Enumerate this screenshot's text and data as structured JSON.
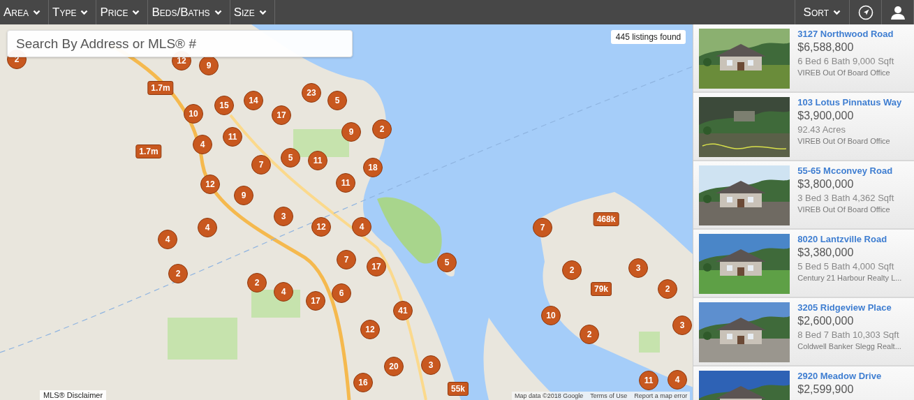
{
  "filters": [
    {
      "label": "Area"
    },
    {
      "label": "Type"
    },
    {
      "label": "Price"
    },
    {
      "label": "Beds/Baths"
    },
    {
      "label": "Size"
    }
  ],
  "sort": {
    "label": "Sort"
  },
  "search": {
    "placeholder": "Search By Address or MLS® #"
  },
  "listing_count": "445 listings found",
  "markers": [
    {
      "kind": "cluster",
      "label": "2"
    },
    {
      "kind": "cluster",
      "label": "12"
    },
    {
      "kind": "cluster",
      "label": "9"
    },
    {
      "kind": "price",
      "label": "1.7m"
    },
    {
      "kind": "cluster",
      "label": "23"
    },
    {
      "kind": "cluster",
      "label": "5"
    },
    {
      "kind": "cluster",
      "label": "14"
    },
    {
      "kind": "cluster",
      "label": "15"
    },
    {
      "kind": "cluster",
      "label": "10"
    },
    {
      "kind": "cluster",
      "label": "17"
    },
    {
      "kind": "cluster",
      "label": "9"
    },
    {
      "kind": "cluster",
      "label": "2"
    },
    {
      "kind": "cluster",
      "label": "11"
    },
    {
      "kind": "cluster",
      "label": "4"
    },
    {
      "kind": "price",
      "label": "1.7m"
    },
    {
      "kind": "cluster",
      "label": "5"
    },
    {
      "kind": "cluster",
      "label": "11"
    },
    {
      "kind": "cluster",
      "label": "7"
    },
    {
      "kind": "cluster",
      "label": "18"
    },
    {
      "kind": "cluster",
      "label": "11"
    },
    {
      "kind": "cluster",
      "label": "12"
    },
    {
      "kind": "cluster",
      "label": "9"
    },
    {
      "kind": "cluster",
      "label": "3"
    },
    {
      "kind": "cluster",
      "label": "4"
    },
    {
      "kind": "cluster",
      "label": "12"
    },
    {
      "kind": "cluster",
      "label": "4"
    },
    {
      "kind": "cluster",
      "label": "4"
    },
    {
      "kind": "cluster",
      "label": "7"
    },
    {
      "kind": "cluster",
      "label": "17"
    },
    {
      "kind": "cluster",
      "label": "5"
    },
    {
      "kind": "cluster",
      "label": "2"
    },
    {
      "kind": "cluster",
      "label": "2"
    },
    {
      "kind": "cluster",
      "label": "4"
    },
    {
      "kind": "cluster",
      "label": "17"
    },
    {
      "kind": "cluster",
      "label": "6"
    },
    {
      "kind": "cluster",
      "label": "41"
    },
    {
      "kind": "cluster",
      "label": "12"
    },
    {
      "kind": "cluster",
      "label": "20"
    },
    {
      "kind": "cluster",
      "label": "3"
    },
    {
      "kind": "cluster",
      "label": "16"
    },
    {
      "kind": "price",
      "label": "55k"
    },
    {
      "kind": "cluster",
      "label": "7"
    },
    {
      "kind": "price",
      "label": "468k"
    },
    {
      "kind": "cluster",
      "label": "2"
    },
    {
      "kind": "cluster",
      "label": "3"
    },
    {
      "kind": "price",
      "label": "79k"
    },
    {
      "kind": "cluster",
      "label": "2"
    },
    {
      "kind": "cluster",
      "label": "10"
    },
    {
      "kind": "cluster",
      "label": "2"
    },
    {
      "kind": "cluster",
      "label": "3"
    },
    {
      "kind": "cluster",
      "label": "11"
    },
    {
      "kind": "cluster",
      "label": "4"
    }
  ],
  "map_footer": {
    "disclaimer": "MLS® Disclaimer",
    "attribution": "Map data ©2018 Google",
    "terms": "Terms of Use",
    "report": "Report a map error"
  },
  "listings": [
    {
      "address": "3127 Northwood Road",
      "price": "$6,588,800",
      "details": "6 Bed 6 Bath 9,000 Sqft",
      "office": "VIREB Out Of Board Office"
    },
    {
      "address": "103 Lotus Pinnatus Way",
      "price": "$3,900,000",
      "details": "92.43 Acres",
      "office": "VIREB Out Of Board Office"
    },
    {
      "address": "55-65 Mcconvey Road",
      "price": "$3,800,000",
      "details": "3 Bed 3 Bath 4,362 Sqft",
      "office": "VIREB Out Of Board Office"
    },
    {
      "address": "8020 Lantzville Road",
      "price": "$3,380,000",
      "details": "5 Bed 5 Bath 4,000 Sqft",
      "office": "Century 21 Harbour Realty L..."
    },
    {
      "address": "3205 Ridgeview Place",
      "price": "$2,600,000",
      "details": "8 Bed 7 Bath 10,303 Sqft",
      "office": "Coldwell Banker Slegg Realt..."
    },
    {
      "address": "2920 Meadow Drive",
      "price": "$2,599,900"
    }
  ]
}
